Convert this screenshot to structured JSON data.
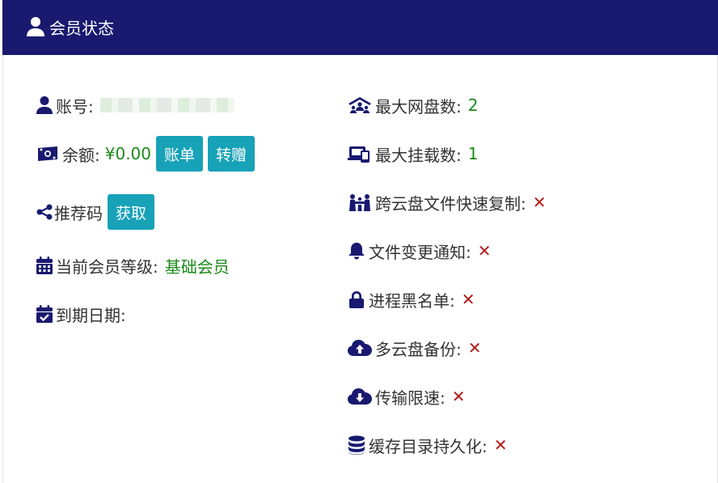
{
  "header": {
    "title": "会员状态",
    "icon": "user-icon"
  },
  "left": {
    "account_label": "账号:",
    "balance_label": "余额:",
    "balance_value": "¥0.00",
    "bill_button": "账单",
    "transfer_button": "转赠",
    "referral_label": "推荐码",
    "get_button": "获取",
    "level_label": "当前会员等级:",
    "level_value": "基础会员",
    "expiry_label": "到期日期:"
  },
  "right": {
    "max_disks_label": "最大网盘数:",
    "max_disks_value": "2",
    "max_mounts_label": "最大挂载数:",
    "max_mounts_value": "1",
    "features": [
      {
        "label": "跨云盘文件快速复制:",
        "value": "✕",
        "icon": "people-icon"
      },
      {
        "label": "文件变更通知:",
        "value": "✕",
        "icon": "bell-icon"
      },
      {
        "label": "进程黑名单:",
        "value": "✕",
        "icon": "lock-icon"
      },
      {
        "label": "多云盘备份:",
        "value": "✕",
        "icon": "cloud-upload-icon"
      },
      {
        "label": "传输限速:",
        "value": "✕",
        "icon": "cloud-download-icon"
      },
      {
        "label": "缓存目录持久化:",
        "value": "✕",
        "icon": "database-icon"
      }
    ]
  },
  "colors": {
    "header_bg": "#191970",
    "button_bg": "#17a2b8",
    "accent_green": "#1a8a1a",
    "cross_red": "#b31b1b"
  }
}
